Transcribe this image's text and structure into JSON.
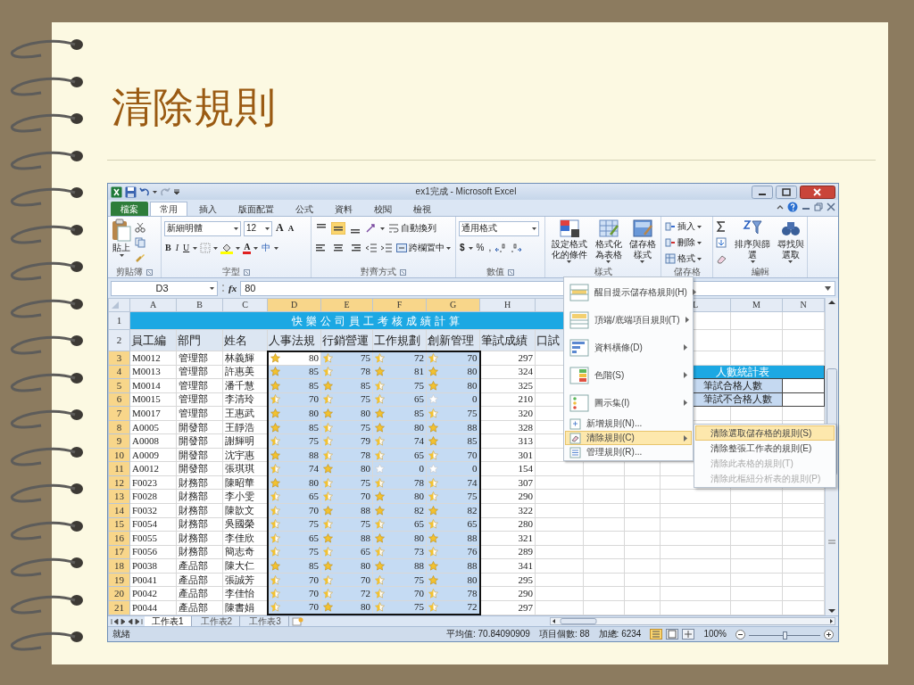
{
  "slide": {
    "title": "清除規則"
  },
  "excel": {
    "title": "ex1完成 - Microsoft Excel",
    "tabs": [
      {
        "label": "檔案",
        "kind": "file",
        "selected": false
      },
      {
        "label": "常用",
        "kind": "tab",
        "selected": true
      },
      {
        "label": "插入",
        "kind": "tab",
        "selected": false
      },
      {
        "label": "版面配置",
        "kind": "tab",
        "selected": false
      },
      {
        "label": "公式",
        "kind": "tab",
        "selected": false
      },
      {
        "label": "資料",
        "kind": "tab",
        "selected": false
      },
      {
        "label": "校閱",
        "kind": "tab",
        "selected": false
      },
      {
        "label": "檢視",
        "kind": "tab",
        "selected": false
      }
    ],
    "ribbon": {
      "clipboard": {
        "paste": "貼上",
        "group": "剪貼簿"
      },
      "font": {
        "name": "新細明體",
        "size": "12",
        "grow": "A",
        "shrink": "A",
        "bold": "B",
        "italic": "I",
        "underline": "U",
        "font_color": "A",
        "phonetic": "中",
        "group": "字型"
      },
      "alignment": {
        "wrap": "自動換列",
        "merge": "跨欄置中",
        "group": "對齊方式"
      },
      "number": {
        "format": "通用格式",
        "currency": "$",
        "percent": "%",
        "comma": ",",
        "group": "數值"
      },
      "styles": {
        "buttons": [
          "設定格式化的條件",
          "格式化為表格",
          "儲存格樣式"
        ],
        "group": "樣式"
      },
      "cells": {
        "buttons": [
          "插入",
          "刪除",
          "格式"
        ],
        "group": "儲存格"
      },
      "editing": {
        "buttons": [
          "排序與篩選",
          "尋找與選取"
        ],
        "group": "編輯"
      }
    },
    "formula_bar": {
      "name_box": "D3",
      "fx": "fx",
      "value": "80"
    },
    "columns": [
      {
        "letter": "A",
        "selected": false
      },
      {
        "letter": "B",
        "selected": false
      },
      {
        "letter": "C",
        "selected": false
      },
      {
        "letter": "D",
        "selected": true
      },
      {
        "letter": "E",
        "selected": true
      },
      {
        "letter": "F",
        "selected": true
      },
      {
        "letter": "G",
        "selected": true
      },
      {
        "letter": "H",
        "selected": false
      }
    ],
    "columns_right": [
      {
        "letter": "L"
      },
      {
        "letter": "M"
      },
      {
        "letter": "N"
      }
    ],
    "title_row": {
      "num": "1",
      "text": "快樂公司員工考核成績計算"
    },
    "header_row": {
      "num": "2",
      "cells": [
        "員工編",
        "部門",
        "姓名",
        "人事法規",
        "行銷營運",
        "工作規劃",
        "創新管理",
        "筆試成績",
        "口試"
      ]
    },
    "rows": [
      {
        "num": "3",
        "selected": true,
        "id": "M0012",
        "dept": "管理部",
        "name": "林義輝",
        "scores": [
          {
            "value": "80",
            "kind": "full",
            "active": true
          },
          {
            "value": "75",
            "kind": "half",
            "active": false
          },
          {
            "value": "72",
            "kind": "half",
            "active": false
          },
          {
            "value": "70",
            "kind": "half",
            "active": false
          }
        ],
        "written": "297"
      },
      {
        "num": "4",
        "selected": true,
        "id": "M0013",
        "dept": "管理部",
        "name": "許惠美",
        "scores": [
          {
            "value": "85",
            "kind": "full",
            "active": false
          },
          {
            "value": "78",
            "kind": "half",
            "active": false
          },
          {
            "value": "81",
            "kind": "full",
            "active": false
          },
          {
            "value": "80",
            "kind": "full",
            "active": false
          }
        ],
        "written": "324"
      },
      {
        "num": "5",
        "selected": true,
        "id": "M0014",
        "dept": "管理部",
        "name": "潘千慧",
        "scores": [
          {
            "value": "85",
            "kind": "full",
            "active": false
          },
          {
            "value": "85",
            "kind": "full",
            "active": false
          },
          {
            "value": "75",
            "kind": "half",
            "active": false
          },
          {
            "value": "80",
            "kind": "full",
            "active": false
          }
        ],
        "written": "325"
      },
      {
        "num": "6",
        "selected": true,
        "id": "M0015",
        "dept": "管理部",
        "name": "李清玲",
        "scores": [
          {
            "value": "70",
            "kind": "half",
            "active": false
          },
          {
            "value": "75",
            "kind": "half",
            "active": false
          },
          {
            "value": "65",
            "kind": "half",
            "active": false
          },
          {
            "value": "0",
            "kind": "empty",
            "active": false
          }
        ],
        "written": "210"
      },
      {
        "num": "7",
        "selected": true,
        "id": "M0017",
        "dept": "管理部",
        "name": "王惠武",
        "scores": [
          {
            "value": "80",
            "kind": "full",
            "active": false
          },
          {
            "value": "80",
            "kind": "full",
            "active": false
          },
          {
            "value": "85",
            "kind": "full",
            "active": false
          },
          {
            "value": "75",
            "kind": "half",
            "active": false
          }
        ],
        "written": "320"
      },
      {
        "num": "8",
        "selected": true,
        "id": "A0005",
        "dept": "開發部",
        "name": "王靜浩",
        "scores": [
          {
            "value": "85",
            "kind": "full",
            "active": false
          },
          {
            "value": "75",
            "kind": "half",
            "active": false
          },
          {
            "value": "80",
            "kind": "full",
            "active": false
          },
          {
            "value": "88",
            "kind": "full",
            "active": false
          }
        ],
        "written": "328"
      },
      {
        "num": "9",
        "selected": true,
        "id": "A0008",
        "dept": "開發部",
        "name": "謝輝明",
        "scores": [
          {
            "value": "75",
            "kind": "half",
            "active": false
          },
          {
            "value": "79",
            "kind": "half",
            "active": false
          },
          {
            "value": "74",
            "kind": "half",
            "active": false
          },
          {
            "value": "85",
            "kind": "full",
            "active": false
          }
        ],
        "written": "313"
      },
      {
        "num": "10",
        "selected": true,
        "id": "A0009",
        "dept": "開發部",
        "name": "沈宇惠",
        "scores": [
          {
            "value": "88",
            "kind": "full",
            "active": false
          },
          {
            "value": "78",
            "kind": "half",
            "active": false
          },
          {
            "value": "65",
            "kind": "half",
            "active": false
          },
          {
            "value": "70",
            "kind": "half",
            "active": false
          }
        ],
        "written": "301"
      },
      {
        "num": "11",
        "selected": true,
        "id": "A0012",
        "dept": "開發部",
        "name": "張琪琪",
        "scores": [
          {
            "value": "74",
            "kind": "half",
            "active": false
          },
          {
            "value": "80",
            "kind": "full",
            "active": false
          },
          {
            "value": "0",
            "kind": "empty",
            "active": false
          },
          {
            "value": "0",
            "kind": "empty",
            "active": false
          }
        ],
        "written": "154"
      },
      {
        "num": "12",
        "selected": true,
        "id": "F0023",
        "dept": "財務部",
        "name": "陳昭華",
        "scores": [
          {
            "value": "80",
            "kind": "full",
            "active": false
          },
          {
            "value": "75",
            "kind": "half",
            "active": false
          },
          {
            "value": "78",
            "kind": "half",
            "active": false
          },
          {
            "value": "74",
            "kind": "half",
            "active": false
          }
        ],
        "written": "307"
      },
      {
        "num": "13",
        "selected": true,
        "id": "F0028",
        "dept": "財務部",
        "name": "李小雯",
        "scores": [
          {
            "value": "65",
            "kind": "half",
            "active": false
          },
          {
            "value": "70",
            "kind": "half",
            "active": false
          },
          {
            "value": "80",
            "kind": "full",
            "active": false
          },
          {
            "value": "75",
            "kind": "half",
            "active": false
          }
        ],
        "written": "290"
      },
      {
        "num": "14",
        "selected": true,
        "id": "F0032",
        "dept": "財務部",
        "name": "陳歆文",
        "scores": [
          {
            "value": "70",
            "kind": "half",
            "active": false
          },
          {
            "value": "88",
            "kind": "full",
            "active": false
          },
          {
            "value": "82",
            "kind": "full",
            "active": false
          },
          {
            "value": "82",
            "kind": "full",
            "active": false
          }
        ],
        "written": "322"
      },
      {
        "num": "15",
        "selected": true,
        "id": "F0054",
        "dept": "財務部",
        "name": "吳國榮",
        "scores": [
          {
            "value": "75",
            "kind": "half",
            "active": false
          },
          {
            "value": "75",
            "kind": "half",
            "active": false
          },
          {
            "value": "65",
            "kind": "half",
            "active": false
          },
          {
            "value": "65",
            "kind": "half",
            "active": false
          }
        ],
        "written": "280"
      },
      {
        "num": "16",
        "selected": true,
        "id": "F0055",
        "dept": "財務部",
        "name": "李佳欣",
        "scores": [
          {
            "value": "65",
            "kind": "half",
            "active": false
          },
          {
            "value": "88",
            "kind": "full",
            "active": false
          },
          {
            "value": "80",
            "kind": "full",
            "active": false
          },
          {
            "value": "88",
            "kind": "full",
            "active": false
          }
        ],
        "written": "321"
      },
      {
        "num": "17",
        "selected": true,
        "id": "F0056",
        "dept": "財務部",
        "name": "簡志奇",
        "scores": [
          {
            "value": "75",
            "kind": "half",
            "active": false
          },
          {
            "value": "65",
            "kind": "half",
            "active": false
          },
          {
            "value": "73",
            "kind": "half",
            "active": false
          },
          {
            "value": "76",
            "kind": "half",
            "active": false
          }
        ],
        "written": "289"
      },
      {
        "num": "18",
        "selected": true,
        "id": "P0038",
        "dept": "產品部",
        "name": "陳大仁",
        "scores": [
          {
            "value": "85",
            "kind": "full",
            "active": false
          },
          {
            "value": "80",
            "kind": "full",
            "active": false
          },
          {
            "value": "88",
            "kind": "full",
            "active": false
          },
          {
            "value": "88",
            "kind": "full",
            "active": false
          }
        ],
        "written": "341"
      },
      {
        "num": "19",
        "selected": true,
        "id": "P0041",
        "dept": "產品部",
        "name": "張誠芳",
        "scores": [
          {
            "value": "70",
            "kind": "half",
            "active": false
          },
          {
            "value": "70",
            "kind": "half",
            "active": false
          },
          {
            "value": "75",
            "kind": "half",
            "active": false
          },
          {
            "value": "80",
            "kind": "full",
            "active": false
          }
        ],
        "written": "295"
      },
      {
        "num": "20",
        "selected": true,
        "id": "P0042",
        "dept": "產品部",
        "name": "李佳怡",
        "scores": [
          {
            "value": "70",
            "kind": "half",
            "active": false
          },
          {
            "value": "72",
            "kind": "half",
            "active": false
          },
          {
            "value": "70",
            "kind": "half",
            "active": false
          },
          {
            "value": "78",
            "kind": "half",
            "active": false
          }
        ],
        "written": "290"
      },
      {
        "num": "21",
        "selected": true,
        "id": "P0044",
        "dept": "產品部",
        "name": "陳書娟",
        "scores": [
          {
            "value": "70",
            "kind": "half",
            "active": false
          },
          {
            "value": "80",
            "kind": "full",
            "active": false
          },
          {
            "value": "75",
            "kind": "half",
            "active": false
          },
          {
            "value": "72",
            "kind": "half",
            "active": false
          }
        ],
        "written": "297"
      }
    ],
    "stats_table": {
      "title": "人數統計表",
      "rows": [
        {
          "label": "筆試合格人數"
        },
        {
          "label": "筆試不合格人數"
        }
      ]
    },
    "menu": [
      {
        "label": "醒目提示儲存格規則(H)",
        "kind": "large",
        "submenu": true,
        "selected": false
      },
      {
        "label": "頂端/底端項目規則(T)",
        "kind": "large",
        "submenu": true,
        "selected": false
      },
      {
        "label": "資料橫條(D)",
        "kind": "large",
        "submenu": true,
        "selected": false
      },
      {
        "label": "色階(S)",
        "kind": "large",
        "submenu": true,
        "selected": false
      },
      {
        "label": "圖示集(I)",
        "kind": "large",
        "submenu": true,
        "selected": false
      },
      {
        "label": "新增規則(N)...",
        "kind": "small",
        "submenu": false,
        "selected": false
      },
      {
        "label": "清除規則(C)",
        "kind": "small",
        "submenu": true,
        "selected": true
      },
      {
        "label": "管理規則(R)...",
        "kind": "small",
        "submenu": false,
        "selected": false
      }
    ],
    "submenu": [
      {
        "label": "清除選取儲存格的規則(S)",
        "selected": true,
        "disabled": false
      },
      {
        "label": "清除整張工作表的規則(E)",
        "selected": false,
        "disabled": false
      },
      {
        "label": "清除此表格的規則(T)",
        "selected": false,
        "disabled": true
      },
      {
        "label": "清除此樞紐分析表的規則(P)",
        "selected": false,
        "disabled": true
      }
    ],
    "sheet_tabs": [
      {
        "label": "工作表1",
        "selected": true
      },
      {
        "label": "工作表2",
        "selected": false
      },
      {
        "label": "工作表3",
        "selected": false
      }
    ],
    "status": {
      "ready": "就緒",
      "average": "平均值: 70.84090909",
      "count": "項目個數: 88",
      "sum": "加總: 6234",
      "zoom": "100%",
      "zoom_slider": {
        "level": 0.5
      }
    }
  }
}
